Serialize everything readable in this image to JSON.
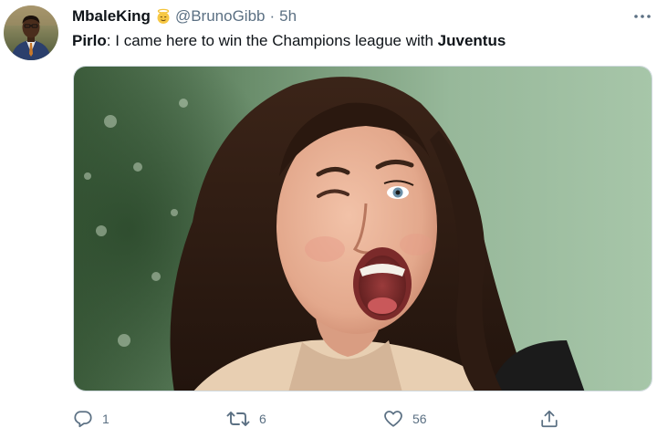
{
  "tweet": {
    "display_name": "MbaleKing",
    "handle": "@BrunoGibb",
    "separator": "·",
    "timestamp": "5h",
    "badge_icon": "angel-face-emoji-icon",
    "text": {
      "speaker": "Pirlo",
      "colon": ":",
      "body": " I came here to win the Champions league with ",
      "emphasis": "Juventus"
    },
    "media": {
      "type": "photo"
    }
  },
  "actions": {
    "reply": {
      "icon": "reply-bubble-icon",
      "count": "1"
    },
    "retweet": {
      "icon": "retweet-icon",
      "count": "6"
    },
    "like": {
      "icon": "heart-icon",
      "count": "56"
    },
    "share": {
      "icon": "share-upload-icon"
    }
  },
  "colors": {
    "text_primary": "#0f1419",
    "text_secondary": "#5b7083",
    "border": "#cfd9de"
  }
}
